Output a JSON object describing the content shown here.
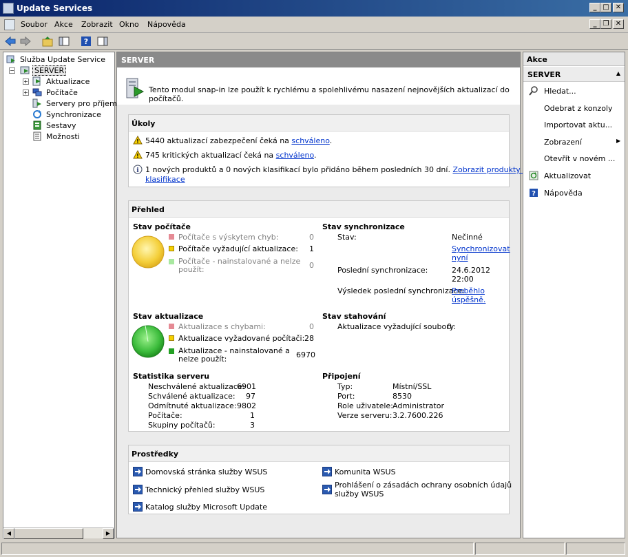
{
  "window": {
    "title": "Update Services"
  },
  "menu": [
    "Soubor",
    "Akce",
    "Zobrazit",
    "Okno",
    "Nápověda"
  ],
  "tree": {
    "root": "Služba Update Service",
    "server": "SERVER",
    "items": [
      "Aktualizace",
      "Počítače",
      "Servery pro příjem c",
      "Synchronizace",
      "Sestavy",
      "Možnosti"
    ]
  },
  "center": {
    "header": "SERVER",
    "intro": "Tento modul snap-in lze použít k rychlému a spolehlivému nasazení nejnovějších aktualizací do počítačů.",
    "tasks": {
      "title": "Úkoly",
      "t1_text": "5440 aktualizací zabezpečení čeká na ",
      "t1_link": "schváleno",
      "t1_end": ".",
      "t2_text": "745 kritických aktualizací čeká na ",
      "t2_link": "schváleno",
      "t2_end": ".",
      "t3_text": "1 nových produktů a 0 nových klasifikací bylo přidáno během posledních 30 dní.",
      "t3_link1": "Zobrazit produkty a",
      "t3_link2": "klasifikace"
    },
    "overview": {
      "title": "Přehled",
      "computer_status": {
        "title": "Stav počítače",
        "rows": [
          {
            "label": "Počítače s výskytem chyb:",
            "value": "0"
          },
          {
            "label": "Počítače vyžadující aktualizace:",
            "value": "1"
          },
          {
            "label1": "Počítače - nainstalované a nelze",
            "label2": "použít:",
            "value": "0"
          }
        ]
      },
      "sync_status": {
        "title": "Stav synchronizace",
        "state_label": "Stav:",
        "state_value": "Nečinné",
        "sync_link1": "Synchronizovat",
        "sync_link2": "nyní",
        "last_label": "Poslední synchronizace:",
        "last_date": "24.6.2012",
        "last_time": "22:00",
        "result_label": "Výsledek poslední synchronizace:",
        "result_link1": "Proběhlo",
        "result_link2": "úspěšně."
      },
      "update_status": {
        "title": "Stav aktualizace",
        "rows": [
          {
            "label": "Aktualizace s chybami:",
            "value": "0"
          },
          {
            "label": "Aktualizace vyžadované počítači:",
            "value": "28"
          },
          {
            "label1": "Aktualizace - nainstalované a",
            "label2": "nelze použít:",
            "value": "6970"
          }
        ]
      },
      "download_status": {
        "title": "Stav stahování",
        "label": "Aktualizace vyžadující soubory:",
        "value": "0"
      },
      "server_stats": {
        "title": "Statistika serveru",
        "rows": [
          {
            "label": "Neschválené aktualizace:",
            "value": "6901"
          },
          {
            "label": "Schválené aktualizace:",
            "value": "97"
          },
          {
            "label": "Odmítnuté aktualizace:",
            "value": "9802"
          },
          {
            "label": "Počítače:",
            "value": "1"
          },
          {
            "label": "Skupiny počítačů:",
            "value": "3"
          }
        ]
      },
      "connection": {
        "title": "Připojení",
        "rows": [
          {
            "label": "Typ:",
            "value": "Místní/SSL"
          },
          {
            "label": "Port:",
            "value": "8530"
          },
          {
            "label": "Role uživatele:",
            "value": "Administrator"
          },
          {
            "label": "Verze serveru:",
            "value": "3.2.7600.226"
          }
        ]
      }
    },
    "resources": {
      "title": "Prostředky",
      "links": [
        "Domovská stránka služby WSUS",
        "Technický přehled služby WSUS",
        "Katalog služby Microsoft Update",
        "Komunita WSUS"
      ],
      "privacy1": "Prohlášení o zásadách ochrany osobních údajů",
      "privacy2": "služby WSUS"
    }
  },
  "actions": {
    "header": "Akce",
    "sub": "SERVER",
    "items": [
      "Hledat...",
      "Odebrat z konzoly",
      "Importovat aktu...",
      "Zobrazení",
      "Otevřít v novém ...",
      "Aktualizovat",
      "Nápověda"
    ]
  },
  "colors": {
    "link": "#0033cc",
    "error": "#e58a94",
    "warning": "#f5d000",
    "ok": "#6ccf5a",
    "ok_dark": "#23a023"
  }
}
